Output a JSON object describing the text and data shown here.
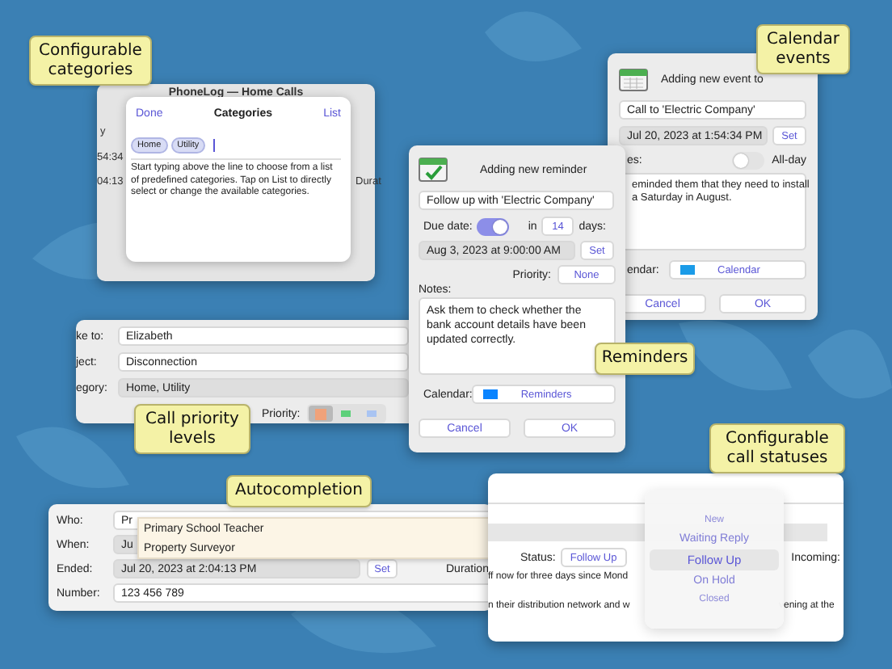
{
  "phonelog_window": {
    "title": "PhoneLog — Home Calls",
    "fragments": [
      "y",
      "54:34",
      "04:13",
      "Durat"
    ]
  },
  "categories_popover": {
    "done": "Done",
    "title": "Categories",
    "list": "List",
    "tokens": [
      "Home",
      "Utility"
    ],
    "help": "Start typing above the line to choose from a list of predefined categories. Tap on List to directly select or change the available categories."
  },
  "event_window": {
    "title": "Adding new event to",
    "event_title": "Call to 'Electric Company'",
    "date": "Jul 20, 2023 at 1:54:34 PM",
    "set": "Set",
    "notes_label": "es:",
    "all_day": {
      "label": "All-day",
      "on": false
    },
    "notes": [
      "eminded them that they need to install",
      "a Saturday in August."
    ],
    "calendar_label": "endar:",
    "calendar": {
      "name": "Calendar",
      "color": "#1a9be8"
    },
    "buttons": [
      "Cancel",
      "OK"
    ]
  },
  "reminder_window": {
    "title": "Adding new reminder",
    "reminder_title": "Follow up with 'Electric Company'",
    "due_date": {
      "label": "Due date:",
      "on": true
    },
    "in_label": "in",
    "days": "14",
    "days_label": "days:",
    "date": "Aug 3, 2023 at 9:00:00 AM",
    "set": "Set",
    "priority_label": "Priority:",
    "priority": "None",
    "notes_label": "Notes:",
    "notes": "Ask them to check whether the bank account details have been updated correctly.",
    "calendar_label": "Calendar:",
    "calendar": {
      "name": "Reminders",
      "color": "#0a84ff"
    },
    "buttons": [
      "Cancel",
      "OK"
    ]
  },
  "contact_panel": {
    "fields": [
      {
        "label": "ke to:",
        "value": "Elizabeth",
        "kind": "input"
      },
      {
        "label": "ject:",
        "value": "Disconnection",
        "kind": "input"
      },
      {
        "label": "egory:",
        "value": "Home, Utility",
        "kind": "readonly"
      }
    ],
    "priority_label": "Priority:",
    "priorities": [
      {
        "color": "#f0a27a",
        "selected": true
      },
      {
        "color": "#5cd07a",
        "selected": false
      },
      {
        "color": "#a9c4f2",
        "selected": false
      }
    ]
  },
  "call_panel": {
    "fields": [
      {
        "label": "Who:",
        "value": "Pr",
        "kind": "input"
      },
      {
        "label": "When:",
        "value": "Ju",
        "kind": "readonly"
      },
      {
        "label": "Ended:",
        "value": "Jul 20, 2023 at 2:04:13 PM",
        "kind": "readonly"
      },
      {
        "label": "Number:",
        "value": "123 456 789",
        "kind": "input"
      }
    ],
    "set": "Set",
    "duration_label": "Duration",
    "suggestions": [
      "Primary School Teacher",
      "Property Surveyor"
    ]
  },
  "status_panel": {
    "status_label": "Status:",
    "status": "Follow Up",
    "incoming_label": "Incoming:",
    "note_fragments": [
      "ff now for three days since Mond",
      "n their distribution network and w",
      "vening at the"
    ],
    "status_options": [
      {
        "label": "New",
        "selected": false
      },
      {
        "label": "Waiting Reply",
        "selected": false
      },
      {
        "label": "Follow Up",
        "selected": true
      },
      {
        "label": "On Hold",
        "selected": false
      },
      {
        "label": "Closed",
        "selected": false
      }
    ]
  },
  "callouts": [
    {
      "text": "Configurable categories"
    },
    {
      "text": "Calendar events"
    },
    {
      "text": "Reminders"
    },
    {
      "text": "Call priority levels"
    },
    {
      "text": "Autocompletion"
    },
    {
      "text": "Configurable call statuses"
    }
  ]
}
